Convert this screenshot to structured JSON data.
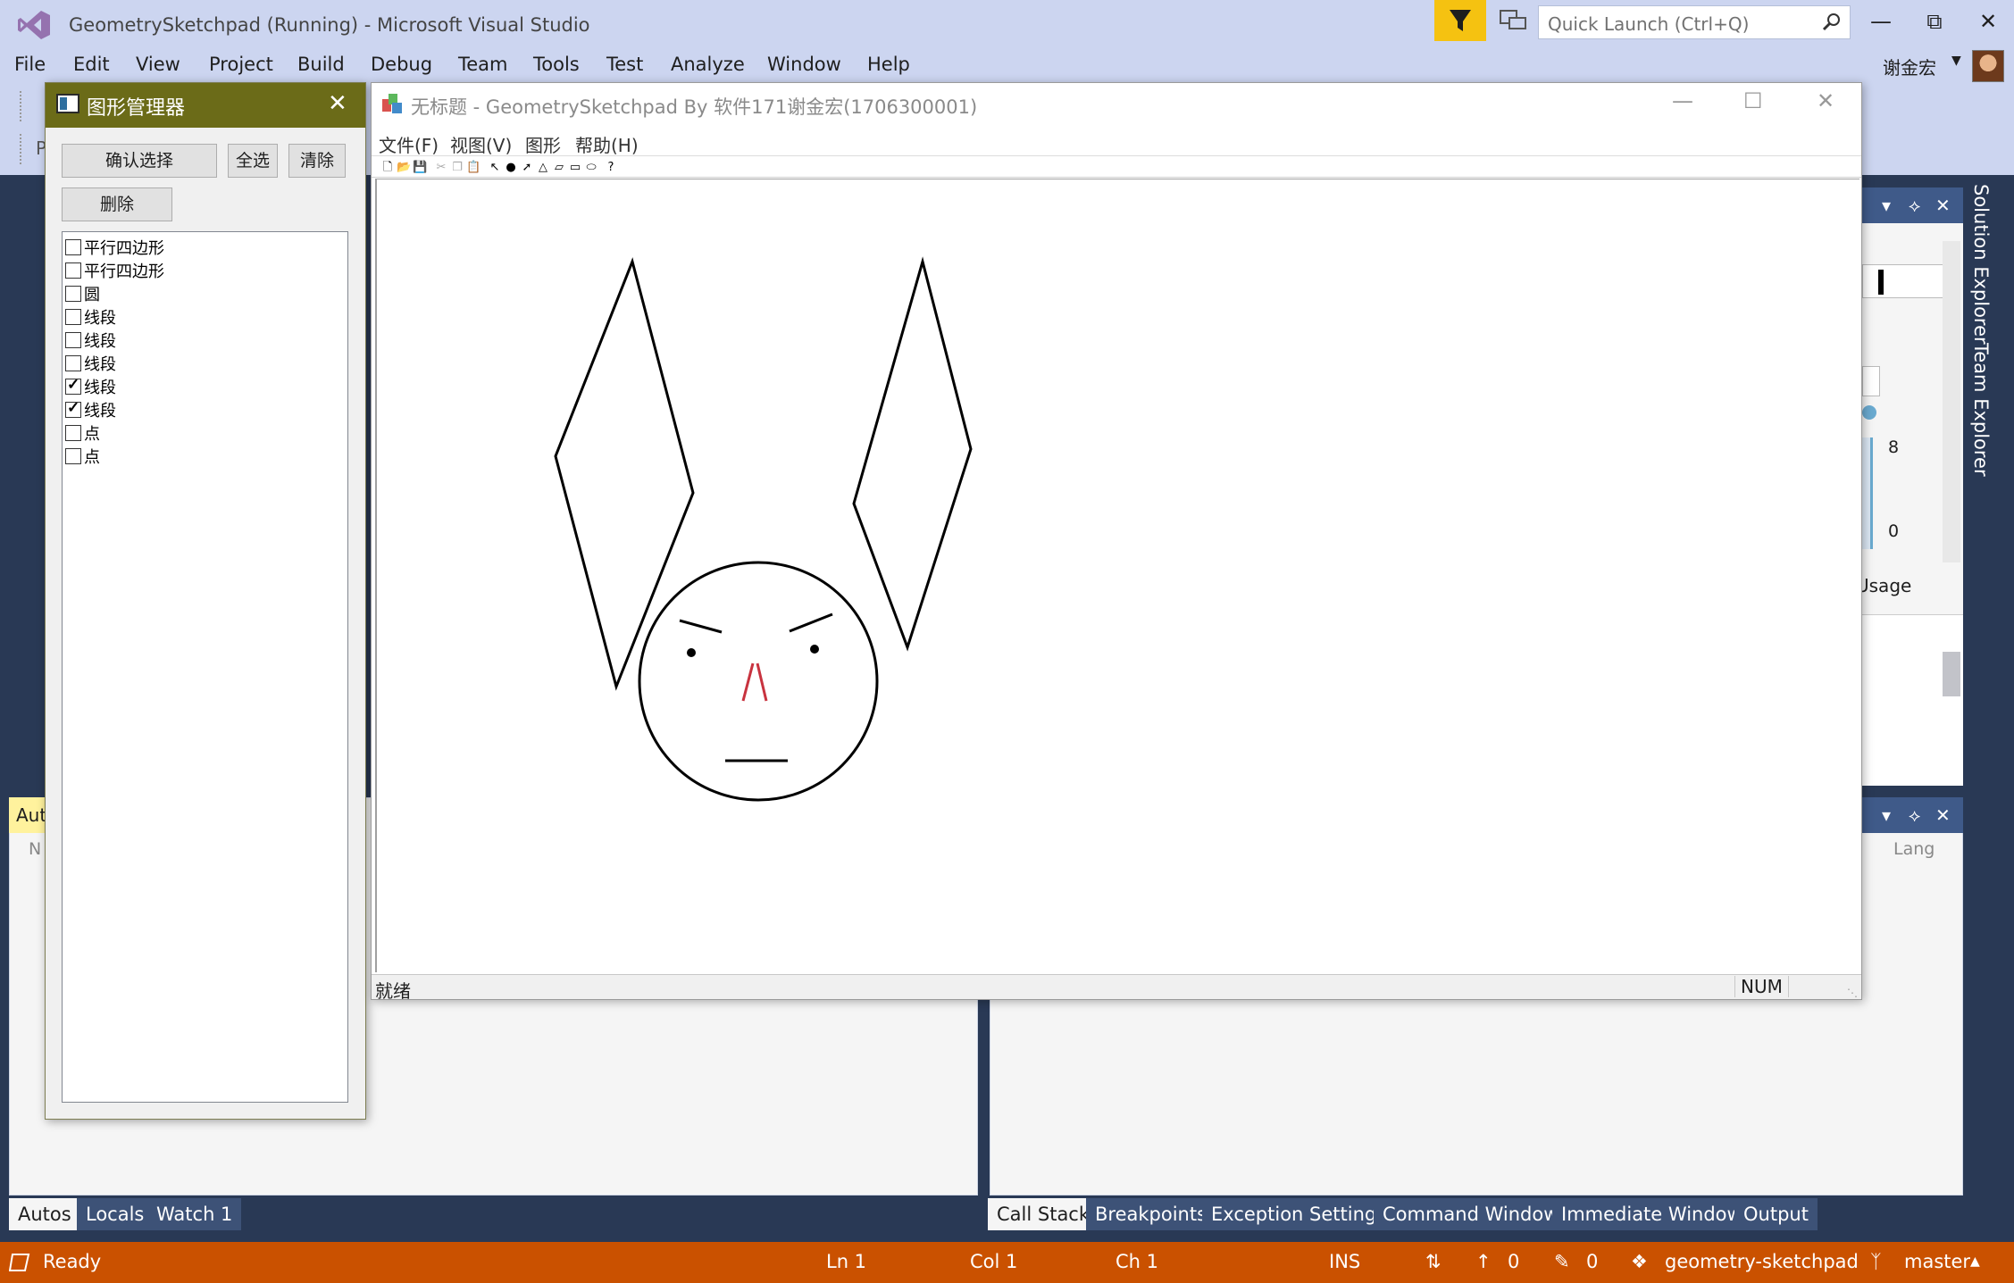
{
  "vs": {
    "title": "GeometrySketchpad (Running) - Microsoft Visual Studio",
    "quick_launch_placeholder": "Quick Launch (Ctrl+Q)",
    "menu": [
      "File",
      "Edit",
      "View",
      "Project",
      "Build",
      "Debug",
      "Team",
      "Tools",
      "Test",
      "Analyze",
      "Window",
      "Help"
    ],
    "user_name": "谢金宏",
    "toolbar_peek_letter": "P",
    "autos_header": "Aut",
    "autos_col_peek": "N",
    "lang_col": "Lang",
    "usage_label": "Usage",
    "sol_number_top": "8",
    "sol_number_bottom": "0",
    "right_tabs": [
      "Solution Explorer",
      "Team Explorer"
    ],
    "bottom_left_tabs": [
      "Autos",
      "Locals",
      "Watch 1"
    ],
    "bottom_right_tabs": [
      "Call Stack",
      "Breakpoints",
      "Exception Settings",
      "Command Window",
      "Immediate Window",
      "Output"
    ],
    "status": {
      "ready": "Ready",
      "ln": "Ln 1",
      "col": "Col 1",
      "ch": "Ch 1",
      "ins": "INS",
      "pull_count": "0",
      "edit_count": "0",
      "repo": "geometry-sketchpad",
      "branch": "master"
    },
    "accent_color": "#ca5100"
  },
  "graphics_manager": {
    "title": "图形管理器",
    "buttons": {
      "confirm": "确认选择",
      "select_all": "全选",
      "clear": "清除",
      "delete": "删除"
    },
    "items": [
      {
        "label": "平行四边形",
        "checked": false
      },
      {
        "label": "平行四边形",
        "checked": false
      },
      {
        "label": "圆",
        "checked": false
      },
      {
        "label": "线段",
        "checked": false
      },
      {
        "label": "线段",
        "checked": false
      },
      {
        "label": "线段",
        "checked": false
      },
      {
        "label": "线段",
        "checked": true
      },
      {
        "label": "线段",
        "checked": true
      },
      {
        "label": "点",
        "checked": false
      },
      {
        "label": "点",
        "checked": false
      }
    ]
  },
  "sketchpad": {
    "title": "无标题 - GeometrySketchpad By 软件171谢金宏(1706300001)",
    "menu": [
      "文件(F)",
      "视图(V)",
      "图形",
      "帮助(H)"
    ],
    "toolbar_icons": [
      "new-icon",
      "open-icon",
      "save-icon",
      "cut-icon",
      "copy-icon",
      "paste-icon",
      "select-icon",
      "point-icon",
      "line-icon",
      "triangle-icon",
      "parallelogram-icon",
      "rectangle-icon",
      "ellipse-icon",
      "help-icon"
    ],
    "status_text": "就绪",
    "status_num": "NUM",
    "highlight_color": "#c8333f"
  }
}
